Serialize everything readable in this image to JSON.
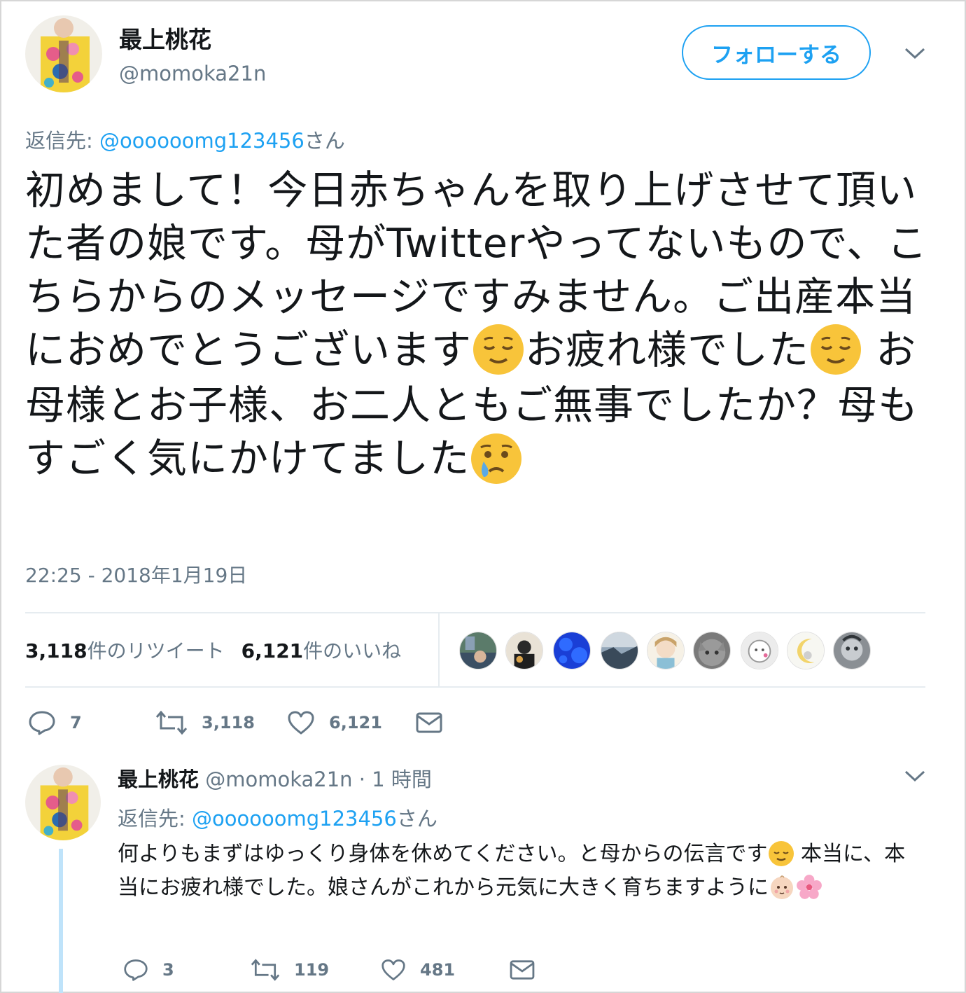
{
  "main_tweet": {
    "display_name": "最上桃花",
    "handle": "@momoka21n",
    "follow_label": "フォローする",
    "reply_prefix": "返信先: ",
    "reply_mention": "@oooooomg123456",
    "reply_suffix": "さん",
    "text_part1": "初めまして！今日赤ちゃんを取り上げさせて頂いた者の娘です。母がTwitterやってないもので、こちらからのメッセージですみません。ご出産本当におめでとうございます",
    "text_part2": "お疲れ様でした",
    "text_part3": " お母様とお子様、お二人ともご無事でしたか？母もすごく気にかけてました",
    "emoji1": "relieved-face",
    "emoji2": "relieved-face",
    "emoji3": "crying-face",
    "timestamp": "22:25 - 2018年1月19日",
    "retweet_count": "3,118",
    "retweet_label": "件のリツイート",
    "like_count": "6,121",
    "like_label": "件のいいね",
    "actions": {
      "reply": "7",
      "retweet": "3,118",
      "like": "6,121"
    }
  },
  "reply_tweet": {
    "display_name": "最上桃花",
    "handle": "@momoka21n",
    "time": " · 1 時間",
    "reply_prefix": "返信先: ",
    "reply_mention": "@oooooomg123456",
    "reply_suffix": "さん",
    "text_part1": "何よりもまずはゆっくり身体を休めてください。と母からの伝言です",
    "text_part2": " 本当に、本当にお疲れ様でした。娘さんがこれから元気に大きく育ちますように",
    "emoji1": "relieved-face",
    "emoji2": "baby-face",
    "emoji3": "cherry-blossom",
    "actions": {
      "reply": "3",
      "retweet": "119",
      "like": "481"
    }
  },
  "colors": {
    "accent": "#1da1f2",
    "text": "#14171a",
    "secondary": "#657786",
    "divider": "#e6ecf0",
    "thread_line": "#bfe3fa"
  }
}
